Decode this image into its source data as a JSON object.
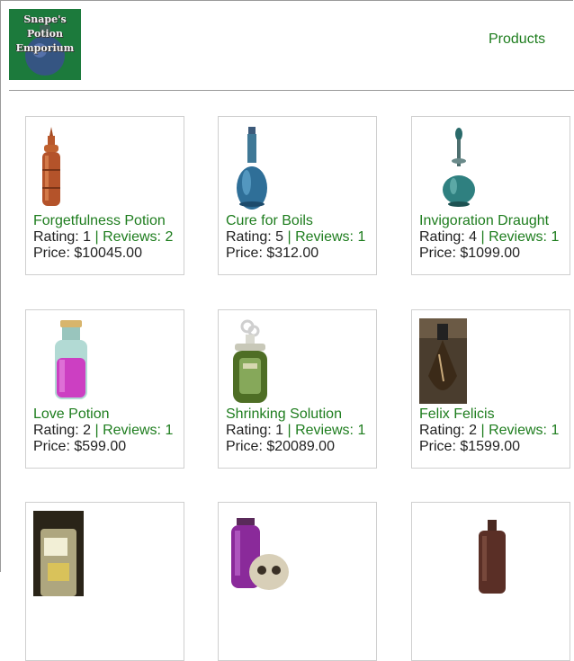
{
  "header": {
    "logo_text": "Snape's\nPotion\nEmporium",
    "nav_products": "Products"
  },
  "labels": {
    "rating": "Rating: ",
    "reviews": "Reviews: ",
    "price": "Price: ",
    "separator": " | "
  },
  "products": [
    {
      "name": "Forgetfulness Potion",
      "rating": "1",
      "reviews": "2",
      "price": "$10045.00",
      "image": "tall-copper-bottle"
    },
    {
      "name": "Cure for Boils",
      "rating": "5",
      "reviews": "1",
      "price": "$312.00",
      "image": "blue-flask"
    },
    {
      "name": "Invigoration Draught",
      "rating": "4",
      "reviews": "1",
      "price": "$1099.00",
      "image": "teal-decanter"
    },
    {
      "name": "Love Potion",
      "rating": "2",
      "reviews": "1",
      "price": "$599.00",
      "image": "pink-potion-jar"
    },
    {
      "name": "Shrinking Solution",
      "rating": "1",
      "reviews": "1",
      "price": "$20089.00",
      "image": "green-bottle"
    },
    {
      "name": "Felix Felicis",
      "rating": "2",
      "reviews": "1",
      "price": "$1599.00",
      "image": "golden-teardrop-vial"
    },
    {
      "name": "",
      "rating": "",
      "reviews": "",
      "price": "",
      "image": "glass-jar"
    },
    {
      "name": "",
      "rating": "",
      "reviews": "",
      "price": "",
      "image": "purple-bottle-with-skull"
    },
    {
      "name": "",
      "rating": "",
      "reviews": "",
      "price": "",
      "image": "brown-bottle"
    }
  ]
}
